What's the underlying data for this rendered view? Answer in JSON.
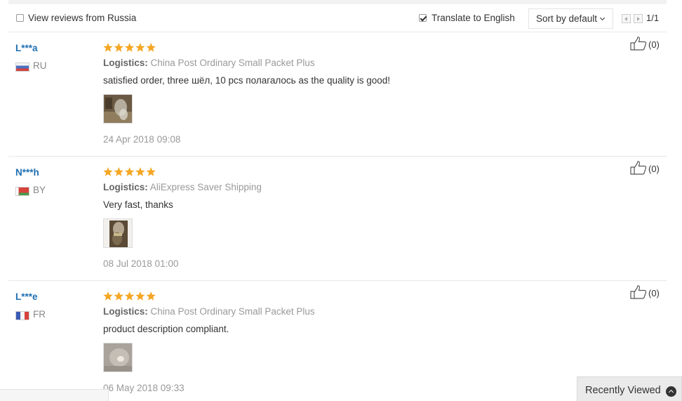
{
  "toolbar": {
    "view_reviews_label": "View reviews from Russia",
    "view_reviews_checked": false,
    "translate_label": "Translate to English",
    "translate_checked": true,
    "sort_label": "Sort by default",
    "page_indicator": "1/1"
  },
  "reviews": [
    {
      "name": "L***a",
      "country": "RU",
      "rating": 5,
      "logistics_label": "Logistics:",
      "logistics": "China Post Ordinary Small Packet Plus",
      "text": "satisfied order, three шёл, 10 pcs полагалось as the quality is good!",
      "date": "24 Apr 2018 09:08",
      "likes": "(0)"
    },
    {
      "name": "N***h",
      "country": "BY",
      "rating": 5,
      "logistics_label": "Logistics:",
      "logistics": "AliExpress Saver Shipping",
      "text": "Very fast, thanks",
      "date": "08 Jul 2018 01:00",
      "likes": "(0)"
    },
    {
      "name": "L***e",
      "country": "FR",
      "rating": 5,
      "logistics_label": "Logistics:",
      "logistics": "China Post Ordinary Small Packet Plus",
      "text": "product description compliant.",
      "date": "06 May 2018 09:33",
      "likes": "(0)"
    }
  ],
  "recently_viewed": {
    "label": "Recently Viewed"
  },
  "colors": {
    "star": "#f5a623",
    "name_link": "#1f6fb2"
  }
}
